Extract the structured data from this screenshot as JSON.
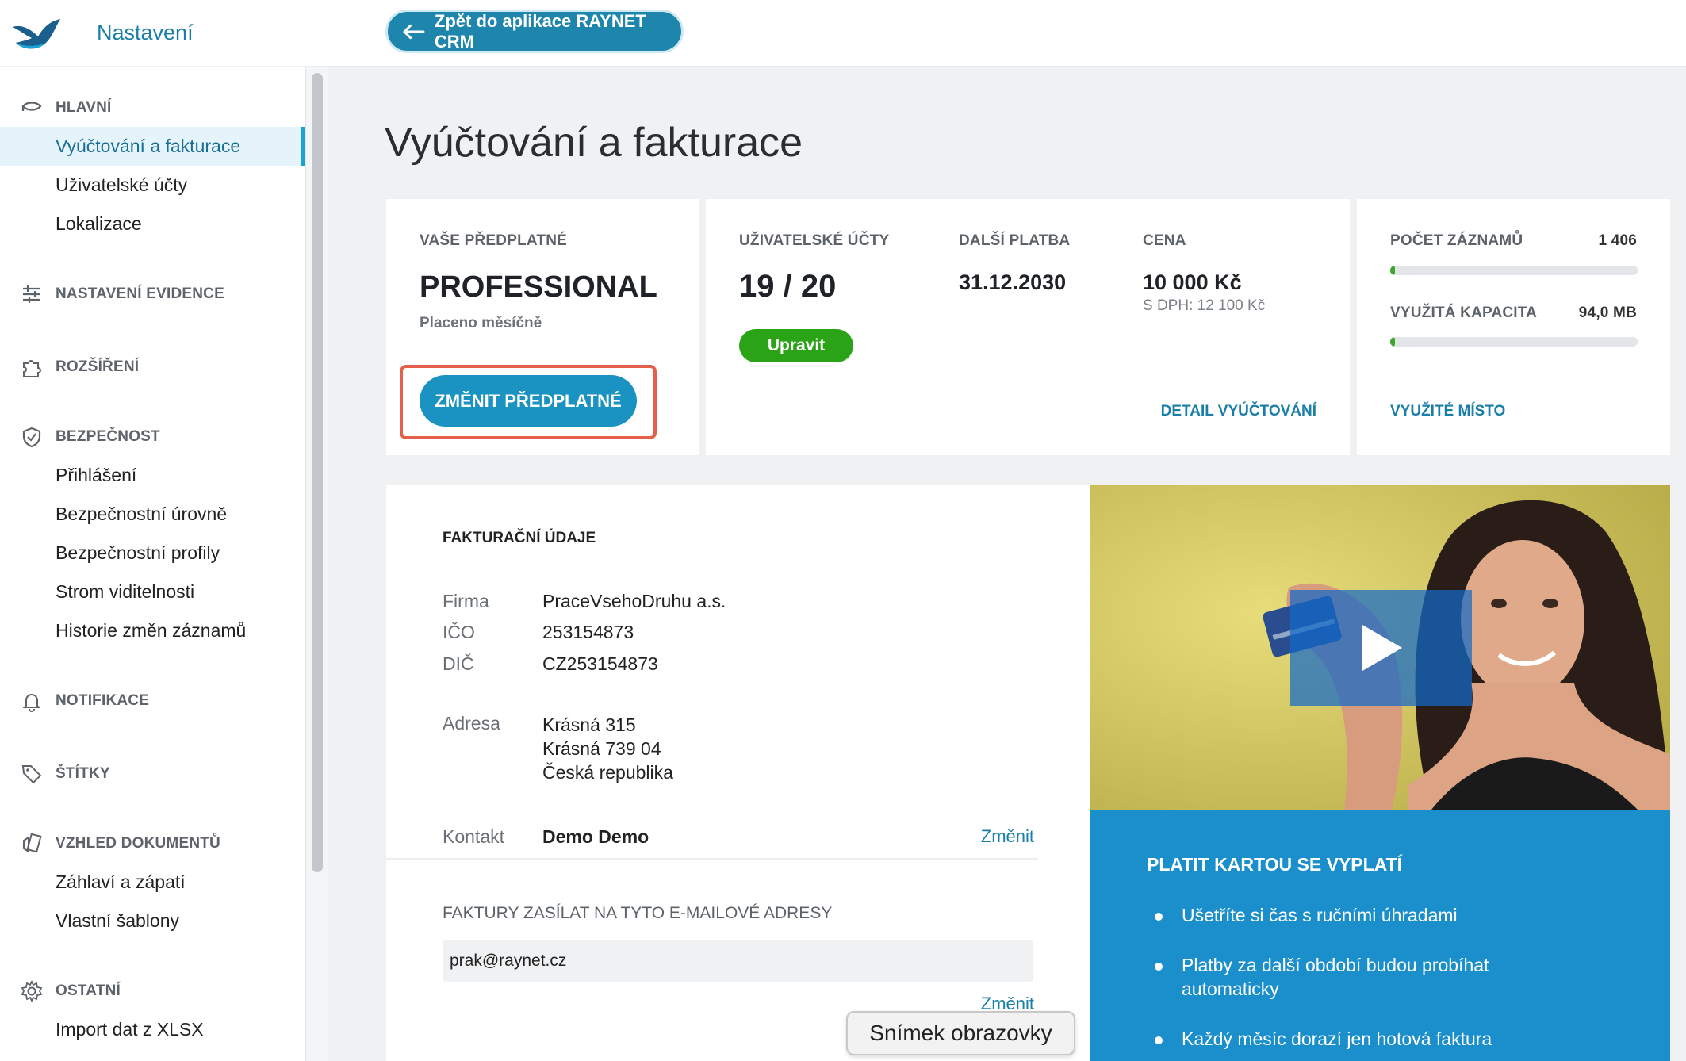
{
  "app": {
    "title": "Nastavení"
  },
  "topbar": {
    "back_label": "Zpět do aplikace RAYNET CRM"
  },
  "sidebar": {
    "sections": {
      "main": "HLAVNÍ",
      "records": "NASTAVENÍ EVIDENCE",
      "extensions": "ROZŠÍŘENÍ",
      "security": "BEZPEČNOST",
      "notifications": "NOTIFIKACE",
      "tags": "ŠTÍTKY",
      "documents": "VZHLED DOKUMENTŮ",
      "other": "OSTATNÍ"
    },
    "items": {
      "billing": "Vyúčtování a fakturace",
      "users": "Uživatelské účty",
      "locale": "Lokalizace",
      "login": "Přihlášení",
      "sec_levels": "Bezpečnostní úrovně",
      "sec_profiles": "Bezpečnostní profily",
      "visibility": "Strom viditelnosti",
      "history": "Historie změn záznamů",
      "header_footer": "Záhlaví a zápatí",
      "templates": "Vlastní šablony",
      "import": "Import dat z XLSX"
    }
  },
  "page": {
    "title": "Vyúčtování a fakturace"
  },
  "subscription": {
    "label": "VAŠE PŘEDPLATNÉ",
    "plan": "PROFESSIONAL",
    "period": "Placeno měsíčně",
    "change_button": "ZMĚNIT PŘEDPLATNÉ"
  },
  "accounts": {
    "users_label": "UŽIVATELSKÉ ÚČTY",
    "users_value": "19 / 20",
    "edit_button": "Upravit",
    "next_payment_label": "DALŠÍ PLATBA",
    "next_payment_value": "31.12.2030",
    "price_label": "CENA",
    "price_value": "10 000 Kč",
    "price_vat": "S DPH: 12 100 Kč",
    "detail_link": "DETAIL VYÚČTOVÁNÍ"
  },
  "usage": {
    "records_label": "POČET ZÁZNAMŮ",
    "records_value": "1 406",
    "records_fill": 0.02,
    "capacity_label": "VYUŽITÁ KAPACITA",
    "capacity_value": "94,0 MB",
    "capacity_fill": 0.02,
    "space_link": "VYUŽITÉ MÍSTO"
  },
  "billing": {
    "title": "FAKTURAČNÍ ÚDAJE",
    "company_label": "Firma",
    "company": "PraceVsehoDruhu a.s.",
    "ico_label": "IČO",
    "ico": "253154873",
    "dic_label": "DIČ",
    "dic": "CZ253154873",
    "address_label": "Adresa",
    "address_1": "Krásná 315",
    "address_2": "Krásná 739 04",
    "address_3": "Česká republika",
    "contact_label": "Kontakt",
    "contact": "Demo Demo",
    "change_link": "Změnit",
    "email_title": "FAKTURY ZASÍLAT NA TYTO E-MAILOVÉ ADRESY",
    "email": "prak@raynet.cz",
    "email_change_link": "Změnit"
  },
  "promo": {
    "title": "PLATIT KARTOU SE VYPLATÍ",
    "bullets": [
      "Ušetříte si čas s ručními úhradami",
      "Platby za další období budou probíhat automaticky",
      "Každý měsíc dorazí jen hotová faktura"
    ]
  },
  "overlay": {
    "tooltip": "Snímek obrazovky"
  },
  "colors": {
    "accent": "#1a93c2",
    "success": "#2ba316",
    "highlight": "#e4604a",
    "promo": "#1b8fcc"
  }
}
